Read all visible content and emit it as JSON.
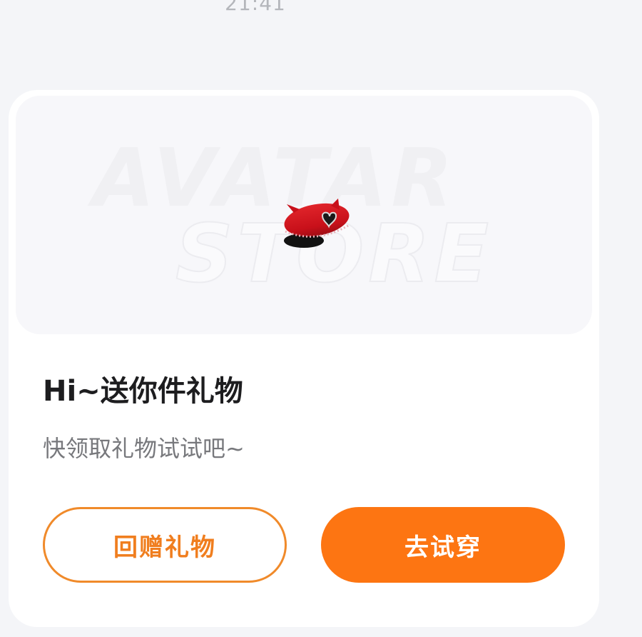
{
  "message": {
    "timestamp": "21:41"
  },
  "gift_card": {
    "banner": {
      "watermark_line1": "AVATAR",
      "watermark_line2": "STORE",
      "item_icon": "red-beret-hat-icon"
    },
    "title": "Hi~送你件礼物",
    "subtitle": "快领取礼物试试吧~",
    "buttons": {
      "return_gift_label": "回赠礼物",
      "try_on_label": "去试穿"
    }
  },
  "colors": {
    "accent": "#fd7512",
    "accent_outline": "#f08a2a",
    "background": "#f4f5f8",
    "card": "#ffffff"
  }
}
